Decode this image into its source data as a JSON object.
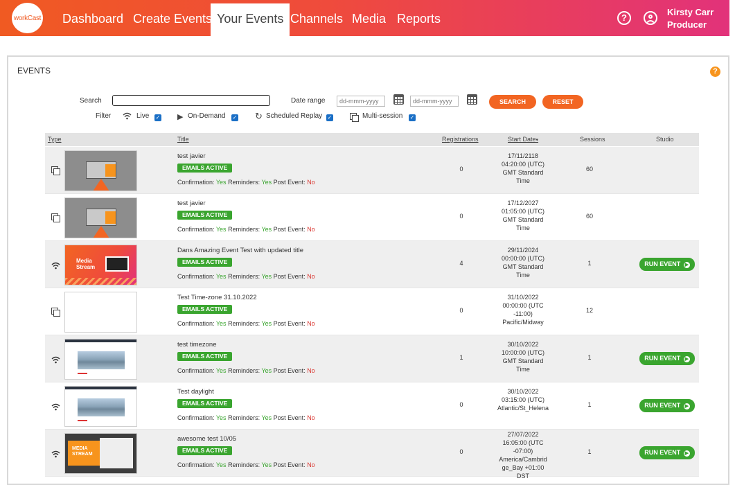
{
  "nav": {
    "logo_text": "workCast",
    "items": [
      {
        "label": "Dashboard"
      },
      {
        "label": "Create Events"
      },
      {
        "label": "Your Events"
      },
      {
        "label": "Channels"
      },
      {
        "label": "Media"
      },
      {
        "label": "Reports"
      }
    ],
    "user_name": "Kirsty Carr",
    "user_role": "Producer"
  },
  "panel": {
    "title": "EVENTS",
    "search_label": "Search",
    "search_value": "",
    "date_range_label": "Date range",
    "date_placeholder": "dd-mmm-yyyy",
    "search_button": "SEARCH",
    "reset_button": "RESET",
    "filter_label": "Filter",
    "filters": [
      {
        "label": "Live",
        "checked": true
      },
      {
        "label": "On-Demand",
        "checked": true
      },
      {
        "label": "Scheduled Replay",
        "checked": true
      },
      {
        "label": "Multi-session",
        "checked": true
      }
    ]
  },
  "table": {
    "headers": {
      "type": "Type",
      "title": "Title",
      "registrations": "Registrations",
      "start_date": "Start Date",
      "sessions": "Sessions",
      "studio": "Studio"
    },
    "status_labels": {
      "confirmation": "Confirmation:",
      "reminders": "Reminders:",
      "post_event": "Post Event:",
      "yes": "Yes",
      "no": "No"
    },
    "badge": "EMAILS ACTIVE",
    "run_label": "RUN EVENT",
    "rows": [
      {
        "type_icon": "multi-session-icon",
        "thumb": "grey",
        "title": "test javier",
        "registrations": "0",
        "date": [
          "17/11/2118",
          "04:20:00 (UTC)",
          "GMT Standard",
          "Time"
        ],
        "sessions": "60",
        "run": false
      },
      {
        "type_icon": "multi-session-icon",
        "thumb": "grey",
        "title": "test javier",
        "registrations": "0",
        "date": [
          "17/12/2027",
          "01:05:00 (UTC)",
          "GMT Standard",
          "Time"
        ],
        "sessions": "60",
        "run": false
      },
      {
        "type_icon": "live-icon",
        "thumb": "orange",
        "title": "Dans Amazing Event Test with updated title",
        "registrations": "4",
        "date": [
          "29/11/2024",
          "00:00:00 (UTC)",
          "GMT Standard",
          "Time"
        ],
        "sessions": "1",
        "run": true
      },
      {
        "type_icon": "multi-session-icon",
        "thumb": "blank",
        "title": "Test Time-zone 31.10.2022",
        "registrations": "0",
        "date": [
          "31/10/2022",
          "00:00:00 (UTC",
          "-11:00)",
          "Pacific/Midway"
        ],
        "sessions": "12",
        "run": false
      },
      {
        "type_icon": "live-icon",
        "thumb": "mountain",
        "title": "test timezone",
        "registrations": "1",
        "date": [
          "30/10/2022",
          "10:00:00 (UTC)",
          "GMT Standard",
          "Time"
        ],
        "sessions": "1",
        "run": true
      },
      {
        "type_icon": "live-icon",
        "thumb": "mountain",
        "title": "Test daylight",
        "registrations": "0",
        "date": [
          "30/10/2022",
          "03:15:00 (UTC)",
          "Atlantic/St_Helena"
        ],
        "sessions": "1",
        "run": true
      },
      {
        "type_icon": "live-icon",
        "thumb": "dark",
        "title": "awesome test 10/05",
        "registrations": "0",
        "date": [
          "27/07/2022",
          "16:05:00 (UTC",
          "-07:00)",
          "America/Cambrid",
          "ge_Bay +01:00",
          "DST"
        ],
        "sessions": "1",
        "run": true
      }
    ]
  },
  "colors": {
    "brand_orange": "#f05a22",
    "brand_pink": "#e2327a",
    "active_green": "#3aa52f",
    "no_red": "#d9322c",
    "checkbox_blue": "#1a6fc6"
  }
}
